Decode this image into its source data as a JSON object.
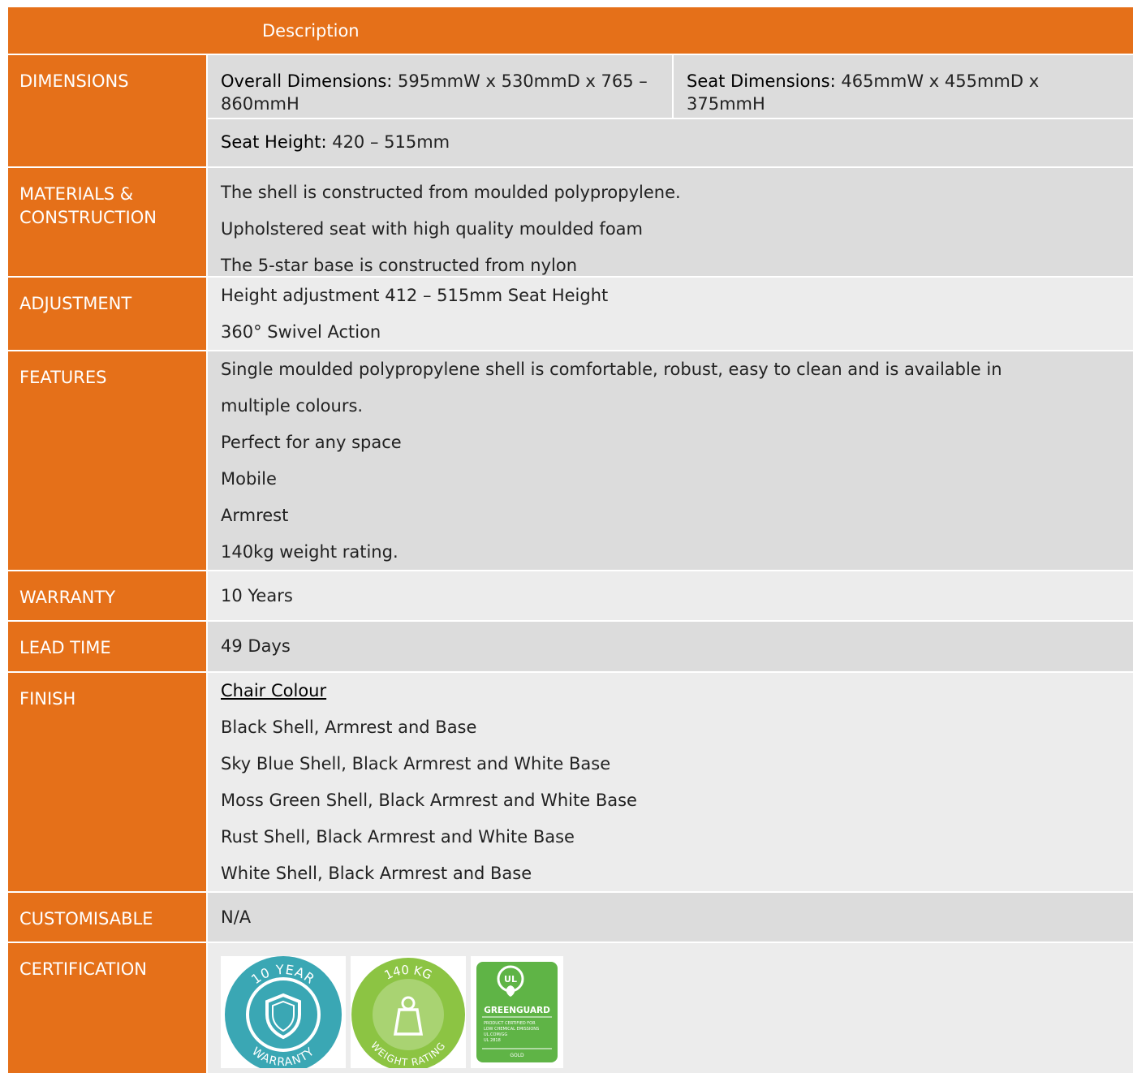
{
  "header": {
    "title": "Description"
  },
  "dimensions": {
    "label": "DIMENSIONS",
    "overall_label": "Overall Dimensions:",
    "overall_value": " 595mmW x 530mmD x 765 – 860mmH",
    "seat_dim_label": "Seat Dimensions:",
    "seat_dim_value": " 465mmW x 455mmD x 375mmH",
    "seat_height_label": "Seat Height:",
    "seat_height_value": " 420 – 515mm"
  },
  "materials": {
    "label": "MATERIALS & CONSTRUCTION",
    "items": [
      "The shell is constructed from moulded polypropylene.",
      "Upholstered seat with high quality moulded foam",
      "The 5-star base is constructed from nylon"
    ]
  },
  "adjustment": {
    "label": "ADJUSTMENT",
    "items": [
      "Height adjustment 412 – 515mm Seat Height",
      "360° Swivel Action"
    ]
  },
  "features": {
    "label": "FEATURES",
    "items": [
      "Single moulded polypropylene shell is comfortable, robust, easy to clean and is available in",
      "multiple colours.",
      "Perfect for any space",
      "Mobile",
      "Armrest",
      "140kg weight rating."
    ]
  },
  "warranty": {
    "label": "WARRANTY",
    "value": "10 Years"
  },
  "lead_time": {
    "label": "LEAD TIME",
    "value": "49 Days"
  },
  "finish": {
    "label": "FINISH",
    "heading": "Chair Colour",
    "items": [
      "Black Shell, Armrest and Base",
      "Sky Blue Shell, Black Armrest and White Base",
      "Moss Green Shell, Black Armrest and White Base",
      "Rust Shell, Black Armrest and White Base",
      "White Shell, Black Armrest and Base"
    ]
  },
  "customisable": {
    "label": "CUSTOMISABLE",
    "value": "N/A"
  },
  "certification": {
    "label": "CERTIFICATION",
    "badges": [
      {
        "top_text": "10 YEAR",
        "bottom_text": "WARRANTY",
        "icon": "shield-icon",
        "color": "#3aa7b4"
      },
      {
        "top_text": "140 KG",
        "bottom_text": "WEIGHT RATING",
        "icon": "weight-icon",
        "color": "#8cc443"
      },
      {
        "top_text": "UL",
        "title": "GREENGUARD",
        "small_lines": [
          "PRODUCT CERTIFIED FOR",
          "LOW CHEMICAL EMISSIONS",
          "UL.COM/GG",
          "UL 2818"
        ],
        "grade": "GOLD",
        "color": "#5fb446"
      }
    ]
  },
  "colors": {
    "accent": "#e57019",
    "row_dark": "#dcdcdc",
    "row_light": "#ececec"
  }
}
